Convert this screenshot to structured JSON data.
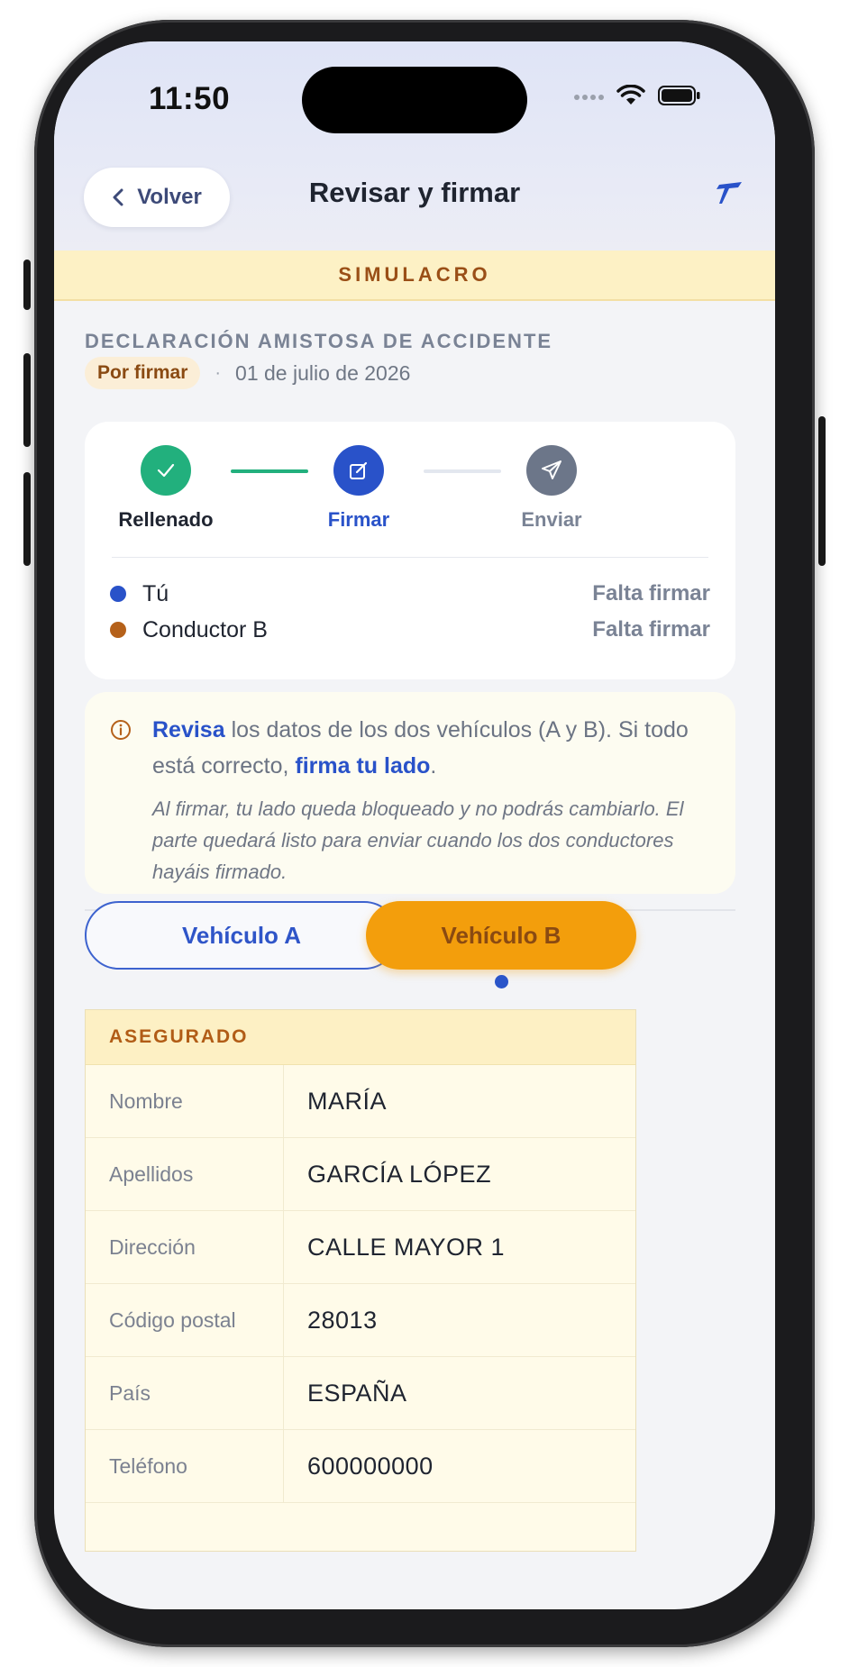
{
  "status_bar": {
    "time": "11:50"
  },
  "nav": {
    "back_label": "Volver",
    "title": "Revisar y firmar"
  },
  "banner": {
    "text": "SIMULACRO"
  },
  "document": {
    "type": "DECLARACIÓN AMISTOSA DE ACCIDENTE",
    "status_pill": "Por firmar",
    "separator": "·",
    "date": "01 de julio de 2026"
  },
  "steps": [
    {
      "label": "Rellenado",
      "state": "done",
      "icon": "check-icon",
      "color": "#22b07d"
    },
    {
      "label": "Firmar",
      "state": "current",
      "icon": "edit-icon",
      "color": "#2952c9"
    },
    {
      "label": "Enviar",
      "state": "pending",
      "icon": "send-icon",
      "color": "#6c7689"
    }
  ],
  "signers": [
    {
      "name": "Tú",
      "status": "Falta firmar",
      "color": "#2952c9"
    },
    {
      "name": "Conductor B",
      "status": "Falta firmar",
      "color": "#b5611a"
    }
  ],
  "info": {
    "highlight1": "Revisa",
    "text1": " los datos de los dos vehículos (A y B). Si todo está correcto, ",
    "highlight2": "firma tu lado",
    "text2": ".",
    "note": "Al firmar, tu lado queda bloqueado y no podrás cambiarlo. El parte quedará listo para enviar cuando los dos conductores hayáis firmado."
  },
  "vehicle_tabs": [
    {
      "label": "Vehículo A",
      "selected": false
    },
    {
      "label": "Vehículo B",
      "selected": true
    }
  ],
  "table": {
    "section": "ASEGURADO",
    "rows": [
      {
        "label": "Nombre",
        "value": "MARÍA"
      },
      {
        "label": "Apellidos",
        "value": "GARCÍA LÓPEZ"
      },
      {
        "label": "Dirección",
        "value": "CALLE MAYOR 1"
      },
      {
        "label": "Código postal",
        "value": "28013"
      },
      {
        "label": "País",
        "value": "ESPAÑA"
      },
      {
        "label": "Teléfono",
        "value": "600000000"
      }
    ]
  },
  "colors": {
    "accent_blue": "#2952c9",
    "accent_orange": "#f39e0c",
    "success_green": "#22b07d"
  }
}
